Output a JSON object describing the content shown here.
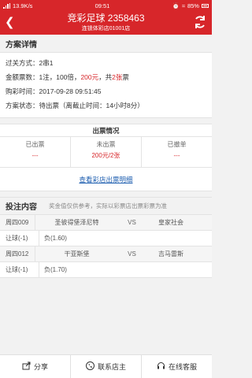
{
  "status_bar": {
    "speed": "13.9K/s",
    "time": "09:51",
    "battery": "85%"
  },
  "header": {
    "title": "竞彩足球 2358463",
    "subtitle": "连锁体彩店01001店"
  },
  "scheme": {
    "section_title": "方案详情",
    "pass_label": "过关方式：",
    "pass_value": "2串1",
    "amount_label": "金额票数：",
    "amount_prefix": "1注，100倍，",
    "amount_price": "200元",
    "amount_mid": "，共",
    "amount_count": "2张",
    "amount_suffix": "票",
    "buy_time_label": "购彩时间：",
    "buy_time_value": "2017-09-28 09:51:45",
    "state_label": "方案状态：",
    "state_value": "待出票（离截止时间：14小时8分）"
  },
  "tickets": {
    "title": "出票情况",
    "issued_label": "已出票",
    "issued_value": "---",
    "pending_label": "未出票",
    "pending_value": "200元/2张",
    "cancelled_label": "已撤单",
    "cancelled_value": "---",
    "detail_link": "查看彩店出票明细"
  },
  "bets": {
    "section_title": "投注内容",
    "note": "奖金值仅供参考，实际以彩票店出票彩票为准",
    "matches": [
      {
        "no": "周四009",
        "home": "圣彼得堡泽尼特",
        "vs": "VS",
        "away": "皇家社会",
        "play": "让球(-1)",
        "odds": "负(1.60)"
      },
      {
        "no": "周四012",
        "home": "干亚斯堡",
        "vs": "VS",
        "away": "吉马雷斯",
        "play": "让球(-1)",
        "odds": "负(1.70)"
      }
    ]
  },
  "bottom": {
    "share": "分享",
    "contact": "联系店主",
    "service": "在线客服"
  },
  "colors": {
    "brand_red": "#d7262a",
    "link_blue": "#1f5fb0"
  }
}
